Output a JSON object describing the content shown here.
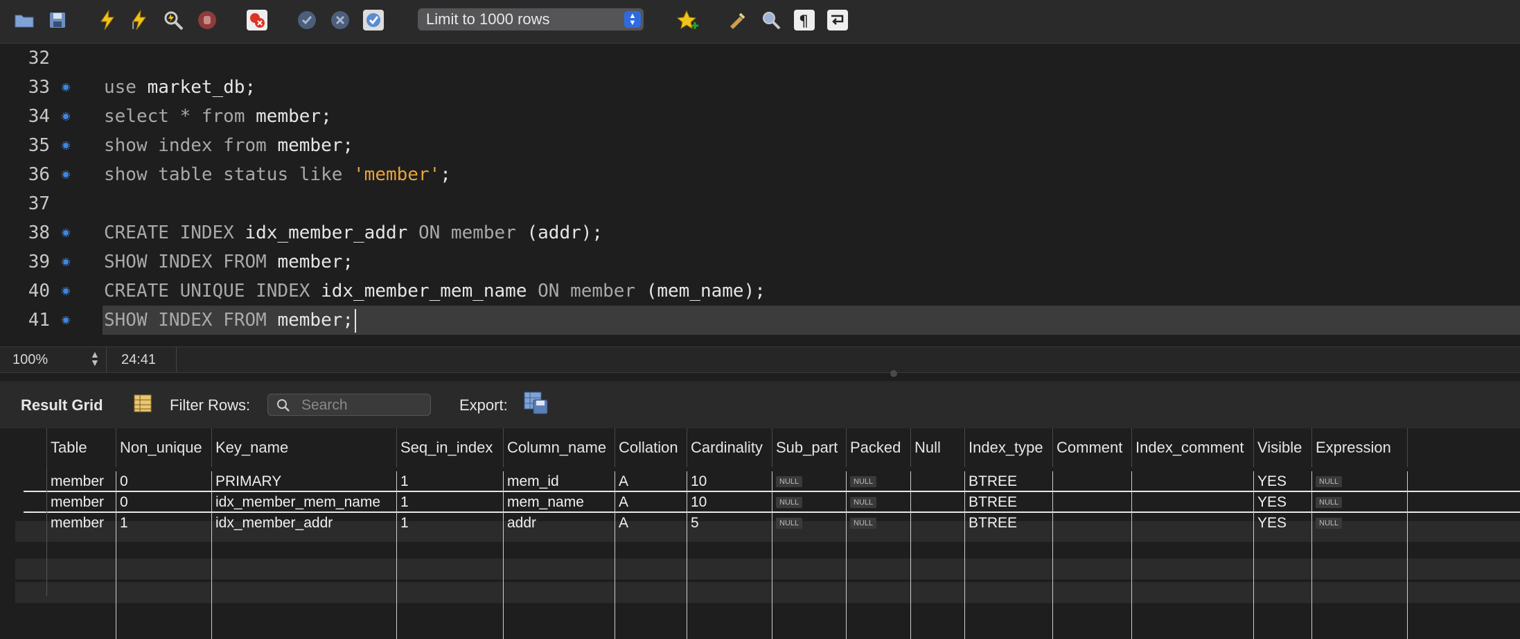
{
  "toolbar": {
    "limit_select": "Limit to 1000 rows",
    "icons": [
      "open-folder-icon",
      "save-icon",
      "execute-icon",
      "execute-current-icon",
      "explain-icon",
      "stop-icon",
      "toggle-error-icon",
      "commit-icon",
      "rollback-icon",
      "autocommit-icon",
      "add-snippet-icon",
      "beautify-icon",
      "find-icon",
      "invisible-chars-icon",
      "wrap-lines-icon"
    ]
  },
  "editor": {
    "lines": [
      {
        "num": "32",
        "dot": false,
        "tokens": []
      },
      {
        "num": "33",
        "dot": true,
        "tokens": [
          {
            "t": "use ",
            "c": "kw"
          },
          {
            "t": "market_db;",
            "c": "id"
          }
        ]
      },
      {
        "num": "34",
        "dot": true,
        "tokens": [
          {
            "t": "select * from ",
            "c": "kw"
          },
          {
            "t": "member;",
            "c": "id"
          }
        ]
      },
      {
        "num": "35",
        "dot": true,
        "tokens": [
          {
            "t": "show index from ",
            "c": "kw"
          },
          {
            "t": "member;",
            "c": "id"
          }
        ]
      },
      {
        "num": "36",
        "dot": true,
        "tokens": [
          {
            "t": "show table status like ",
            "c": "kw"
          },
          {
            "t": "'member'",
            "c": "str"
          },
          {
            "t": ";",
            "c": "id"
          }
        ]
      },
      {
        "num": "37",
        "dot": false,
        "tokens": []
      },
      {
        "num": "38",
        "dot": true,
        "tokens": [
          {
            "t": "CREATE INDEX ",
            "c": "kw"
          },
          {
            "t": "idx_member_addr ",
            "c": "id"
          },
          {
            "t": "ON ",
            "c": "kw"
          },
          {
            "t": "member ",
            "c": "kw"
          },
          {
            "t": "(addr);",
            "c": "id"
          }
        ]
      },
      {
        "num": "39",
        "dot": true,
        "tokens": [
          {
            "t": "SHOW INDEX FROM ",
            "c": "kw"
          },
          {
            "t": "member;",
            "c": "id"
          }
        ]
      },
      {
        "num": "40",
        "dot": true,
        "tokens": [
          {
            "t": "CREATE UNIQUE INDEX ",
            "c": "kw"
          },
          {
            "t": "idx_member_mem_name ",
            "c": "id"
          },
          {
            "t": "ON ",
            "c": "kw"
          },
          {
            "t": "member ",
            "c": "kw"
          },
          {
            "t": "(mem_name);",
            "c": "id"
          }
        ]
      },
      {
        "num": "41",
        "dot": true,
        "highlight": true,
        "tokens": [
          {
            "t": "SHOW INDEX FROM ",
            "c": "kw"
          },
          {
            "t": "member;",
            "c": "id"
          }
        ]
      }
    ]
  },
  "status": {
    "zoom": "100%",
    "cursor_pos": "24:41"
  },
  "results": {
    "title": "Result Grid",
    "filter_label": "Filter Rows:",
    "search_placeholder": "Search",
    "export_label": "Export:",
    "columns": [
      "Table",
      "Non_unique",
      "Key_name",
      "Seq_in_index",
      "Column_name",
      "Collation",
      "Cardinality",
      "Sub_part",
      "Packed",
      "Null",
      "Index_type",
      "Comment",
      "Index_comment",
      "Visible",
      "Expression"
    ],
    "null_text": "NULL",
    "rows": [
      [
        "member",
        "0",
        "PRIMARY",
        "1",
        "mem_id",
        "A",
        "10",
        null,
        null,
        "",
        "BTREE",
        "",
        "",
        "YES",
        null
      ],
      [
        "member",
        "0",
        "idx_member_mem_name",
        "1",
        "mem_name",
        "A",
        "10",
        null,
        null,
        "",
        "BTREE",
        "",
        "",
        "YES",
        null
      ],
      [
        "member",
        "1",
        "idx_member_addr",
        "1",
        "addr",
        "A",
        "5",
        null,
        null,
        "",
        "BTREE",
        "",
        "",
        "YES",
        null
      ]
    ]
  }
}
